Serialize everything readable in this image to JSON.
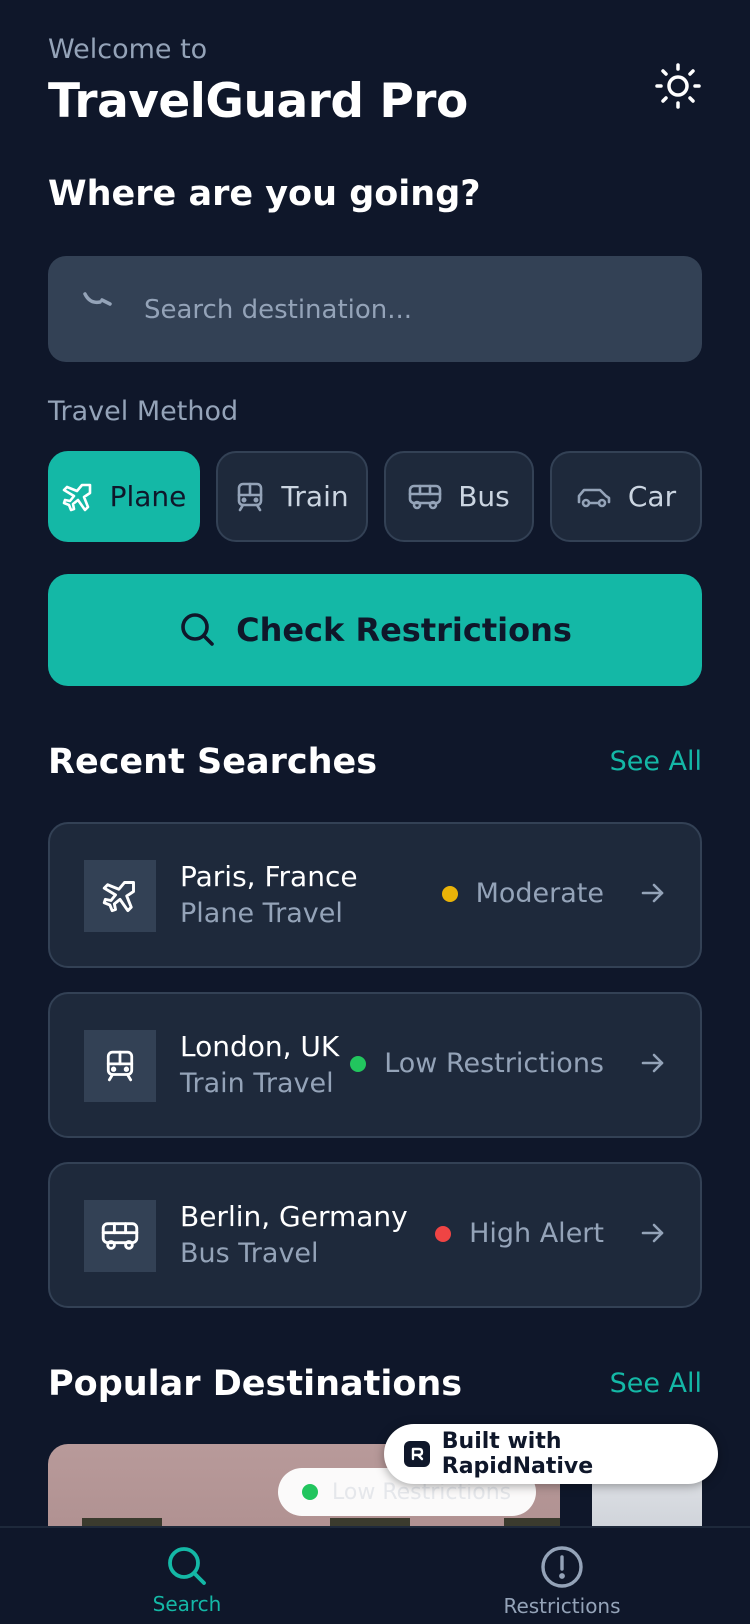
{
  "header": {
    "welcome": "Welcome to",
    "app_title": "TravelGuard Pro"
  },
  "search": {
    "question": "Where are you going?",
    "placeholder": "Search destination...",
    "value": ""
  },
  "travel_method": {
    "label": "Travel Method",
    "options": [
      {
        "label": "Plane",
        "icon": "plane-icon",
        "selected": true
      },
      {
        "label": "Train",
        "icon": "train-icon",
        "selected": false
      },
      {
        "label": "Bus",
        "icon": "bus-icon",
        "selected": false
      },
      {
        "label": "Car",
        "icon": "car-icon",
        "selected": false
      }
    ]
  },
  "check_button": {
    "label": "Check Restrictions"
  },
  "recent": {
    "title": "Recent Searches",
    "see_all": "See All",
    "items": [
      {
        "city": "Paris, France",
        "mode": "Plane Travel",
        "status": "Moderate",
        "status_color": "#eab308",
        "icon": "plane-icon"
      },
      {
        "city": "London, UK",
        "mode": "Train Travel",
        "status": "Low Restrictions",
        "status_color": "#22c55e",
        "icon": "train-icon"
      },
      {
        "city": "Berlin, Germany",
        "mode": "Bus Travel",
        "status": "High Alert",
        "status_color": "#ef4444",
        "icon": "bus-icon"
      }
    ]
  },
  "popular": {
    "title": "Popular Destinations",
    "see_all": "See All",
    "badge": "Low Restrictions"
  },
  "rapidnative": {
    "label": "Built with RapidNative"
  },
  "tabs": [
    {
      "label": "Search",
      "icon": "search-icon",
      "active": true
    },
    {
      "label": "Restrictions",
      "icon": "alert-circle-icon",
      "active": false
    }
  ],
  "colors": {
    "background": "#0f172a",
    "accent": "#14b8a6",
    "card": "#1e293b"
  }
}
